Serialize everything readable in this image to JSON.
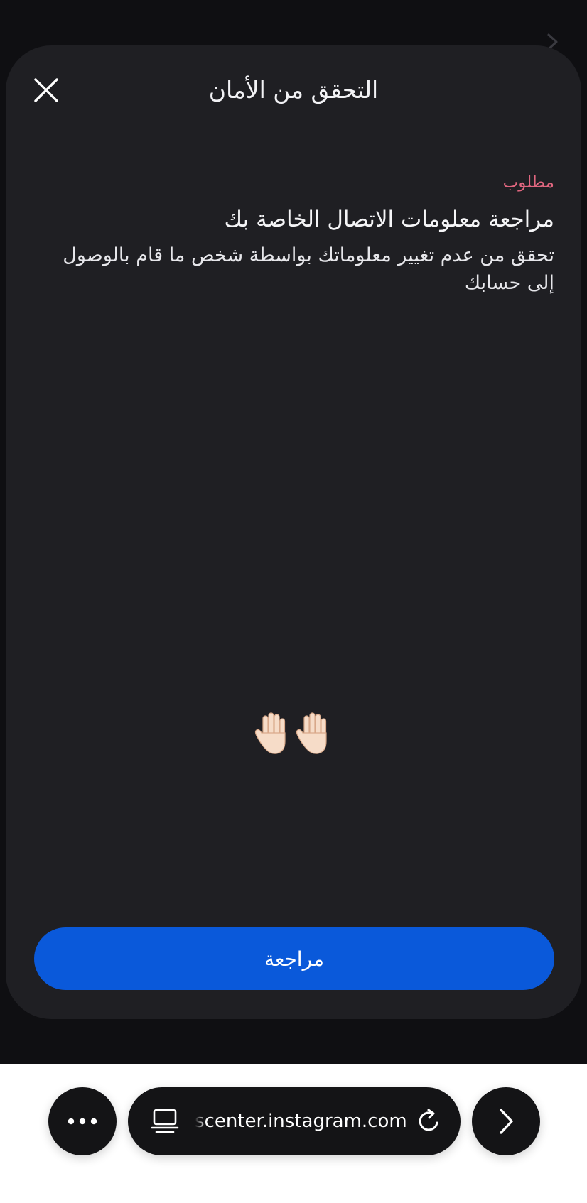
{
  "sheet": {
    "title": "التحقق من الأمان",
    "required_label": "مطلوب",
    "heading": "مراجعة معلومات الاتصال الخاصة بك",
    "description": "تحقق من عدم تغيير معلوماتك بواسطة شخص ما قام بالوصول إلى حسابك",
    "emoji": "🖐🏻🖐🏻",
    "review_button": "مراجعة"
  },
  "browser": {
    "url": "scenter.instagram.com"
  },
  "icons": {
    "close": "close-icon",
    "more": "more-horizontal-icon",
    "tabs": "tabs-icon",
    "reload": "reload-icon",
    "forward": "chevron-right-icon"
  },
  "colors": {
    "sheet_background": "#1f1f23",
    "page_background": "#0f0f12",
    "required_accent": "#e0667f",
    "primary_button": "#0a59da",
    "browser_bar": "#ffffff"
  }
}
